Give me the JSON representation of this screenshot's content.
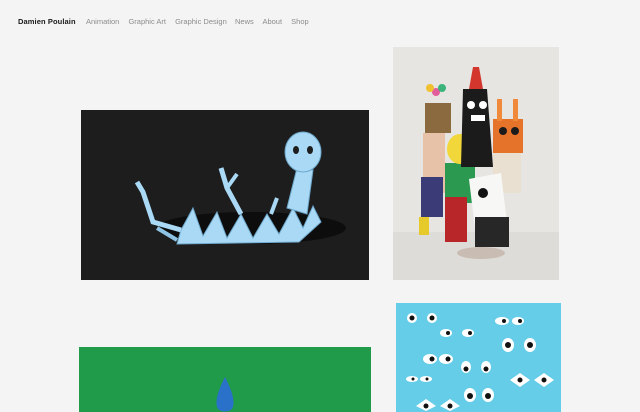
{
  "header": {
    "brand": "Damien Poulain",
    "nav_left": [
      "Animation",
      "Graphic Art",
      "Graphic Design"
    ],
    "nav_right": [
      "News",
      "About",
      "Shop"
    ]
  },
  "colors": {
    "page_bg": "#f4f4f4",
    "worm_bg": "#1d1d1d",
    "worm_blue": "#a9d9f5",
    "masks_bg": "#e6e5e2",
    "green_bg": "#1f9b4a",
    "flame_blue": "#2a72c9",
    "eyes_bg": "#66cde9"
  },
  "tiles": [
    {
      "id": "worm",
      "icon": "paper-worm-artwork"
    },
    {
      "id": "masks",
      "icon": "costumed-group-photo"
    },
    {
      "id": "green",
      "icon": "blue-flame-artwork"
    },
    {
      "id": "eyes",
      "icon": "eyes-pattern-artwork"
    }
  ]
}
